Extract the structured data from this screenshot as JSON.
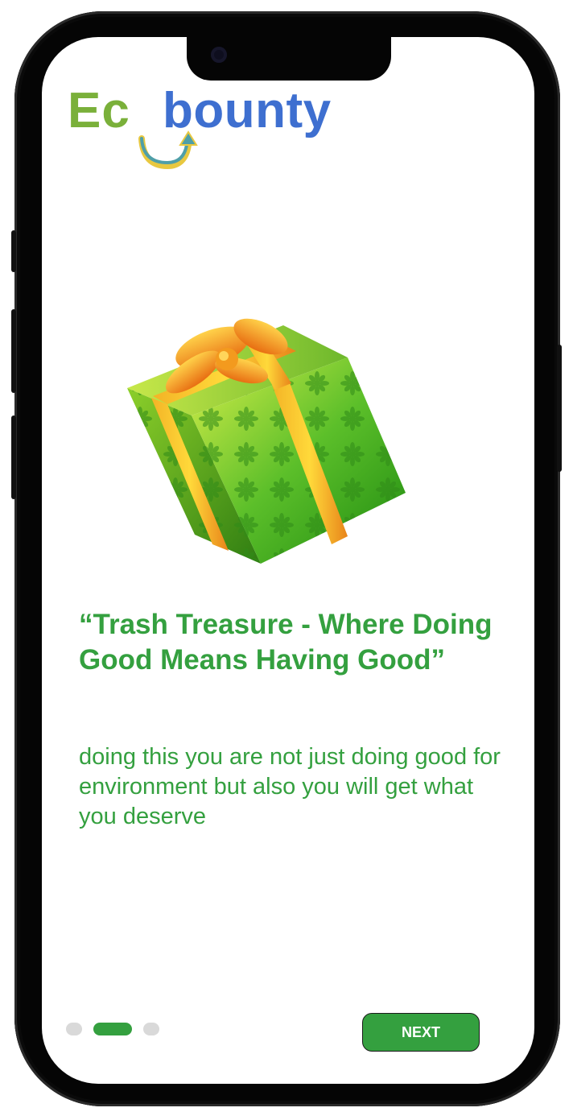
{
  "logo": {
    "part1": "Ec",
    "part2": "bounty",
    "icon": "recycle-arrow-icon"
  },
  "hero": {
    "icon": "gift-box-icon"
  },
  "headline": "“Trash Treasure - Where Doing Good Means Having Good”",
  "body": "doing this you are not just doing good for environment but also you will get what you deserve",
  "pager": {
    "total": 3,
    "active_index": 1
  },
  "next_button": {
    "label": "NEXT"
  },
  "colors": {
    "green": "#34a03f",
    "logo_green": "#7ab03a",
    "logo_blue": "#3e6fd0",
    "dot_inactive": "#d9d9d9"
  }
}
